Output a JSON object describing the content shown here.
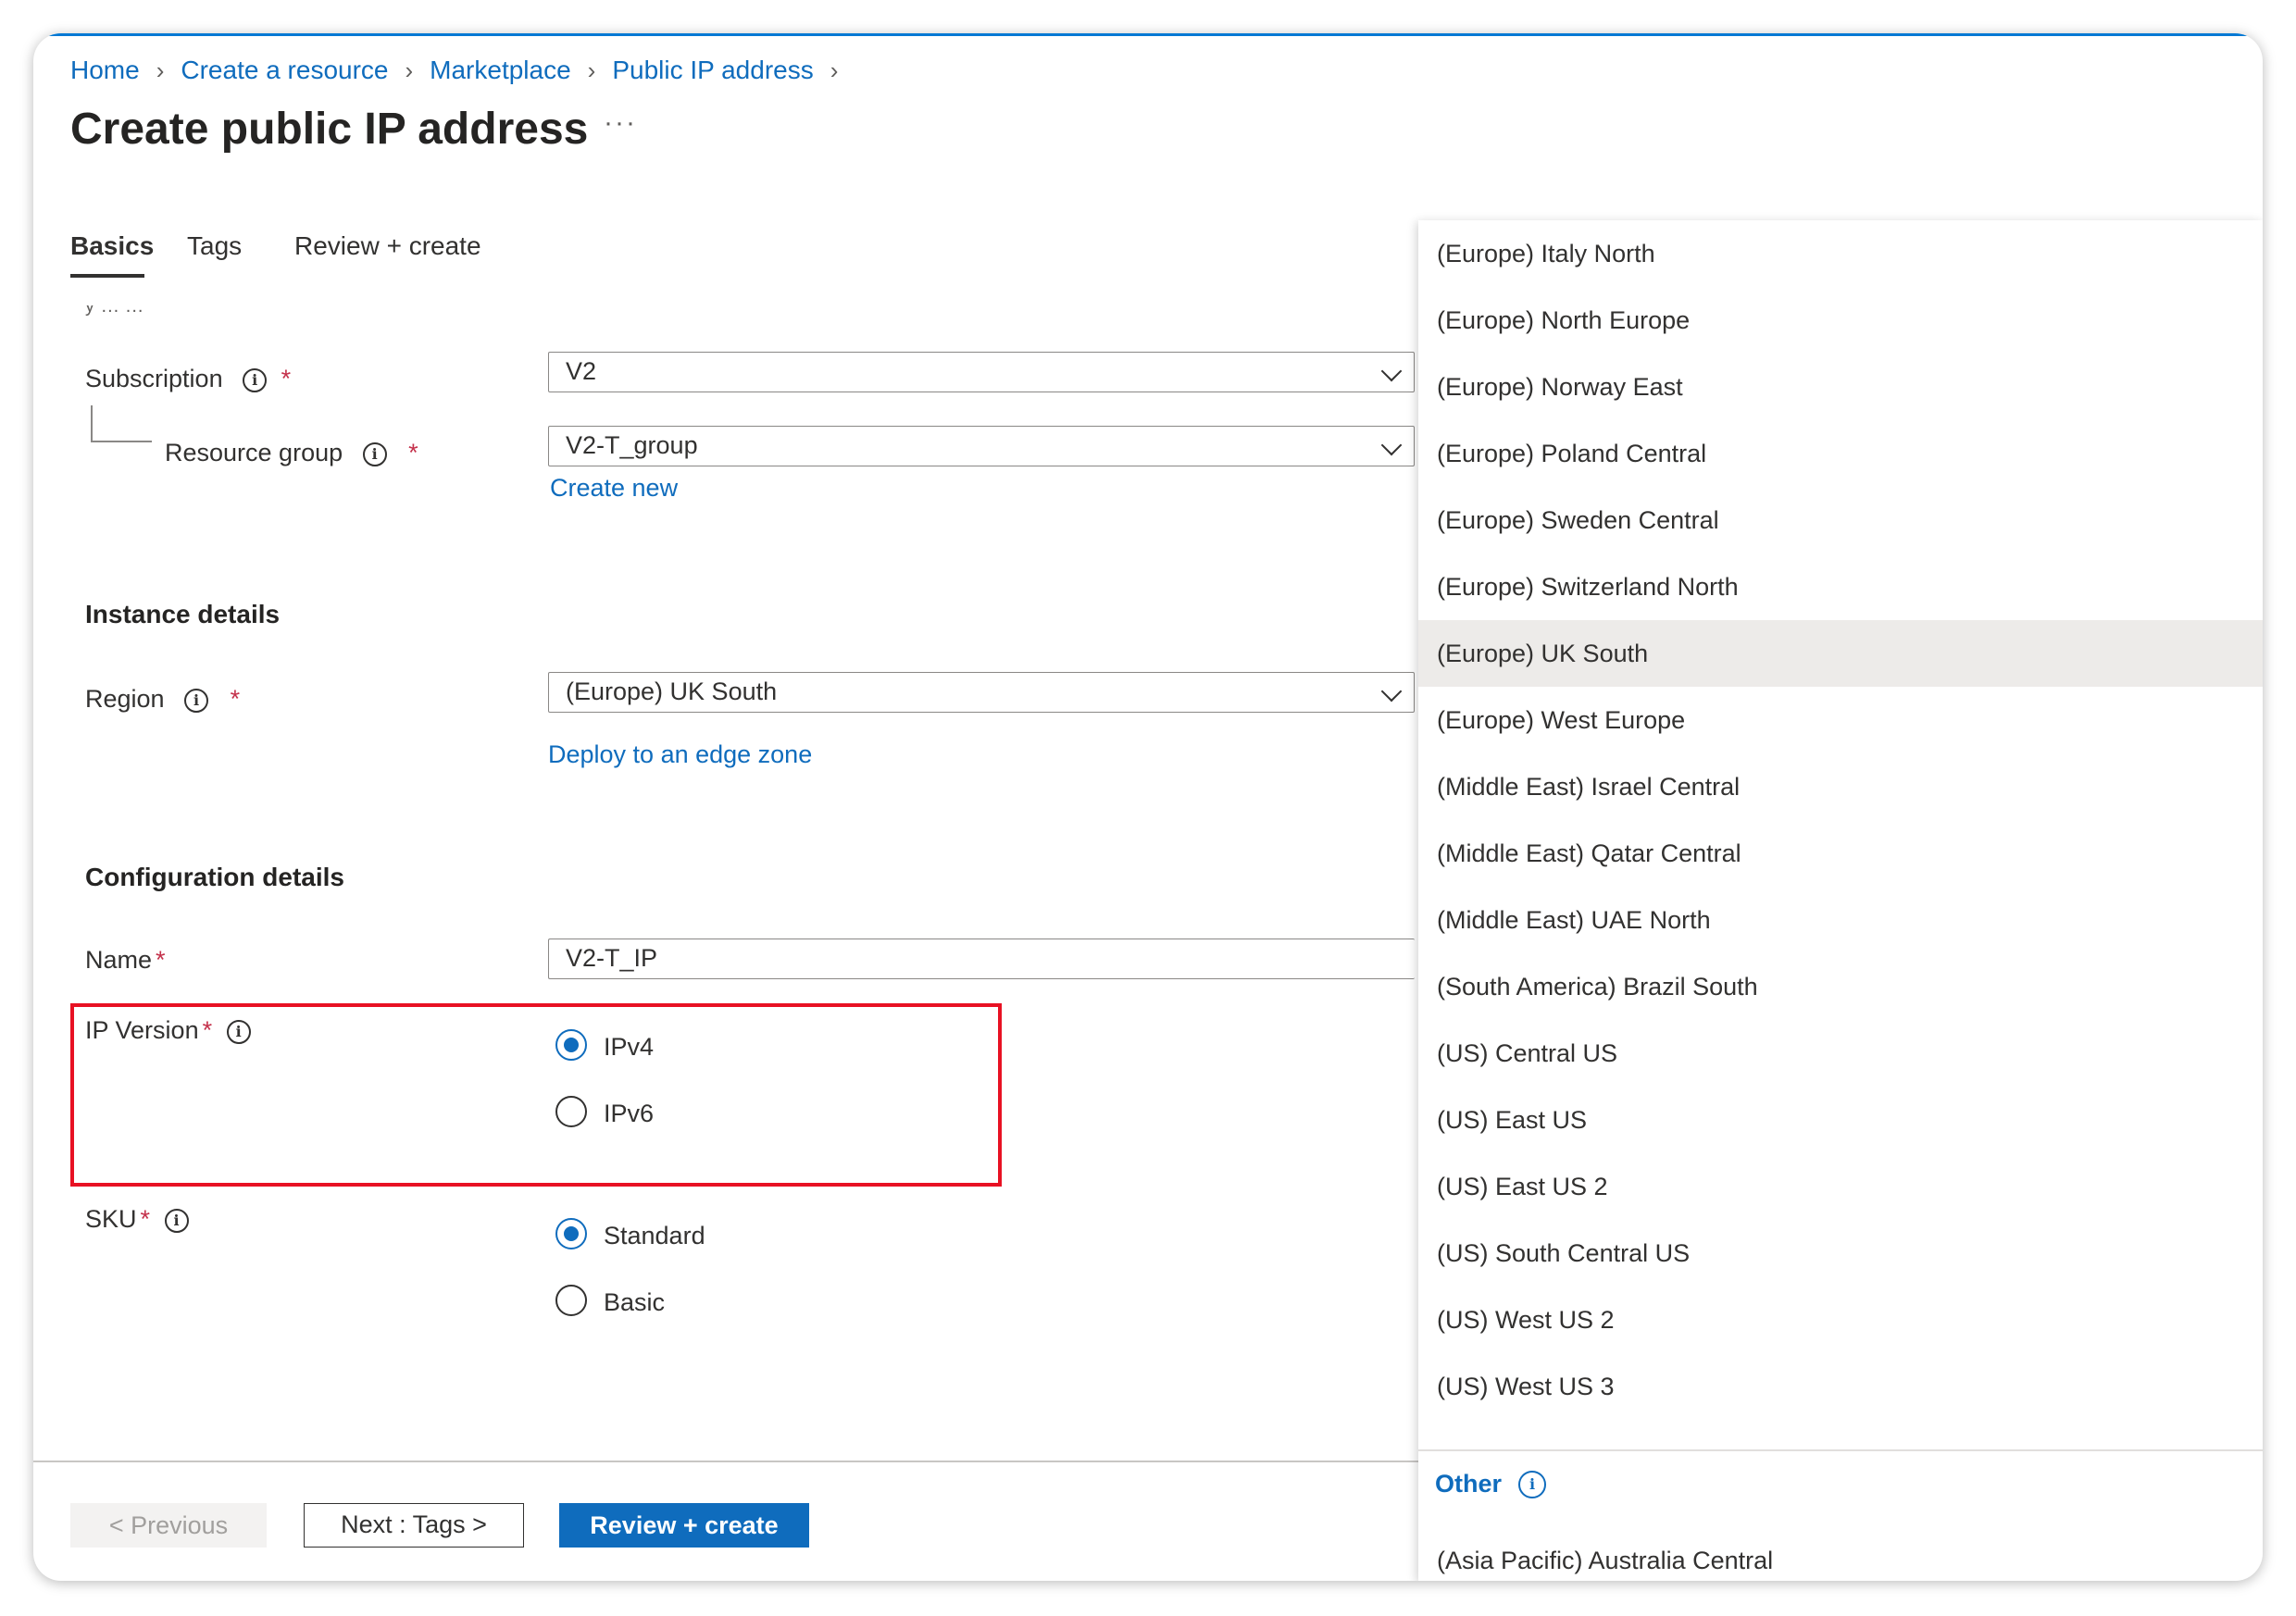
{
  "breadcrumb": [
    "Home",
    "Create a resource",
    "Marketplace",
    "Public IP address"
  ],
  "page": {
    "title": "Create public IP address",
    "more": "···"
  },
  "tabs": [
    "Basics",
    "Tags",
    "Review + create"
  ],
  "project": {
    "cut_label": "y      ...      ...",
    "subscription": {
      "label": "Subscription",
      "value": "V2"
    },
    "resource_group": {
      "label": "Resource group",
      "value": "V2-T_group",
      "link": "Create new"
    }
  },
  "instance": {
    "heading": "Instance details",
    "region": {
      "label": "Region",
      "value": "(Europe) UK South",
      "link": "Deploy to an edge zone"
    }
  },
  "config": {
    "heading": "Configuration details",
    "name": {
      "label": "Name",
      "value": "V2-T_IP"
    },
    "ip_version": {
      "label": "IP Version",
      "options": [
        "IPv4",
        "IPv6"
      ],
      "selected": "IPv4"
    },
    "sku": {
      "label": "SKU",
      "options": [
        "Standard",
        "Basic"
      ],
      "selected": "Standard"
    }
  },
  "footer": {
    "previous": "< Previous",
    "next": "Next : Tags >",
    "review": "Review + create"
  },
  "dropdown": {
    "items": [
      "(Europe) Italy North",
      "(Europe) North Europe",
      "(Europe) Norway East",
      "(Europe) Poland Central",
      "(Europe) Sweden Central",
      "(Europe) Switzerland North",
      "(Europe) UK South",
      "(Europe) West Europe",
      "(Middle East) Israel Central",
      "(Middle East) Qatar Central",
      "(Middle East) UAE North",
      "(South America) Brazil South",
      "(US) Central US",
      "(US) East US",
      "(US) East US 2",
      "(US) South Central US",
      "(US) West US 2",
      "(US) West US 3"
    ],
    "selected_index": 6,
    "other_group": "Other",
    "other_items": [
      "(Asia Pacific) Australia Central"
    ]
  },
  "required_mark": "*",
  "info_glyph": "i",
  "colors": {
    "accent": "#0f6cbd",
    "highlight": "#e81123",
    "required": "#c4314b"
  }
}
